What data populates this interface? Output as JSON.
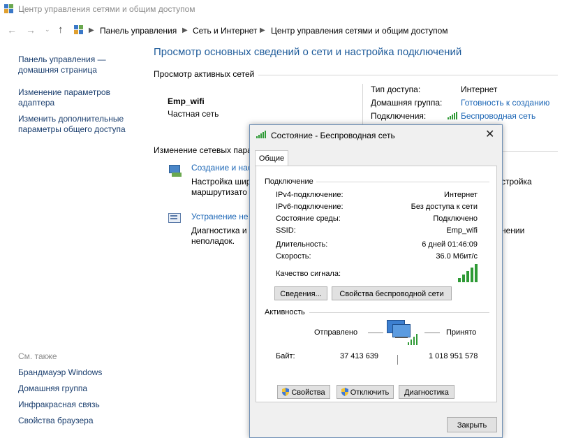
{
  "window": {
    "title": "Центр управления сетями и общим доступом"
  },
  "breadcrumb": [
    "Панель управления",
    "Сеть и Интернет",
    "Центр управления сетями и общим доступом"
  ],
  "left_nav": {
    "home_line1": "Панель управления —",
    "home_line2": "домашняя страница",
    "adapter_line1": "Изменение параметров",
    "adapter_line2": "адаптера",
    "sharing_line1": "Изменить дополнительные",
    "sharing_line2": "параметры общего доступа",
    "see_also_label": "См. также",
    "see_also": [
      "Брандмауэр Windows",
      "Домашняя группа",
      "Инфракрасная связь",
      "Свойства браузера"
    ]
  },
  "main": {
    "heading": "Просмотр основных сведений о сети и настройка подключений",
    "active_networks": "Просмотр активных сетей",
    "network_name": "Emp_wifi",
    "network_type": "Частная сеть",
    "access_type_label": "Тип доступа:",
    "access_type_value": "Интернет",
    "homegroup_label": "Домашняя группа:",
    "homegroup_value": "Готовность к созданию",
    "connections_label": "Подключения:",
    "connections_value": "Беспроводная сеть",
    "change_settings": "Изменение сетевых пара",
    "create_link": "Создание и нас",
    "create_desc1": "Настройка шир",
    "create_desc1_tail": "стройка",
    "create_desc2": "маршрутизато",
    "troubleshoot_link": "Устранение не",
    "troubleshoot_desc1": "Диагностика и",
    "troubleshoot_desc1_tail": "нении",
    "troubleshoot_desc2": "неполадок."
  },
  "dialog": {
    "title": "Состояние - Беспроводная сеть",
    "tab": "Общие",
    "connection_group": "Подключение",
    "rows": [
      {
        "label": "IPv4-подключение:",
        "value": "Интернет"
      },
      {
        "label": "IPv6-подключение:",
        "value": "Без доступа к сети"
      },
      {
        "label": "Состояние среды:",
        "value": "Подключено"
      },
      {
        "label": "SSID:",
        "value": "Emp_wifi"
      },
      {
        "label": "Длительность:",
        "value": "6 дней 01:46:09"
      },
      {
        "label": "Скорость:",
        "value": "36.0 Мбит/с"
      }
    ],
    "signal_label": "Качество сигнала:",
    "details_button": "Сведения...",
    "wireless_props_button": "Свойства беспроводной сети",
    "activity_group": "Активность",
    "sent_label": "Отправлено",
    "received_label": "Принято",
    "bytes_label": "Байт:",
    "bytes_sent": "37 413 639",
    "bytes_received": "1 018 951 578",
    "properties_button": "Свойства",
    "disable_button": "Отключить",
    "diagnose_button": "Диагностика",
    "close_button": "Закрыть"
  },
  "colors": {
    "link": "#1a65b5",
    "heading": "#1e5b9a",
    "signal": "#2e9a35"
  }
}
